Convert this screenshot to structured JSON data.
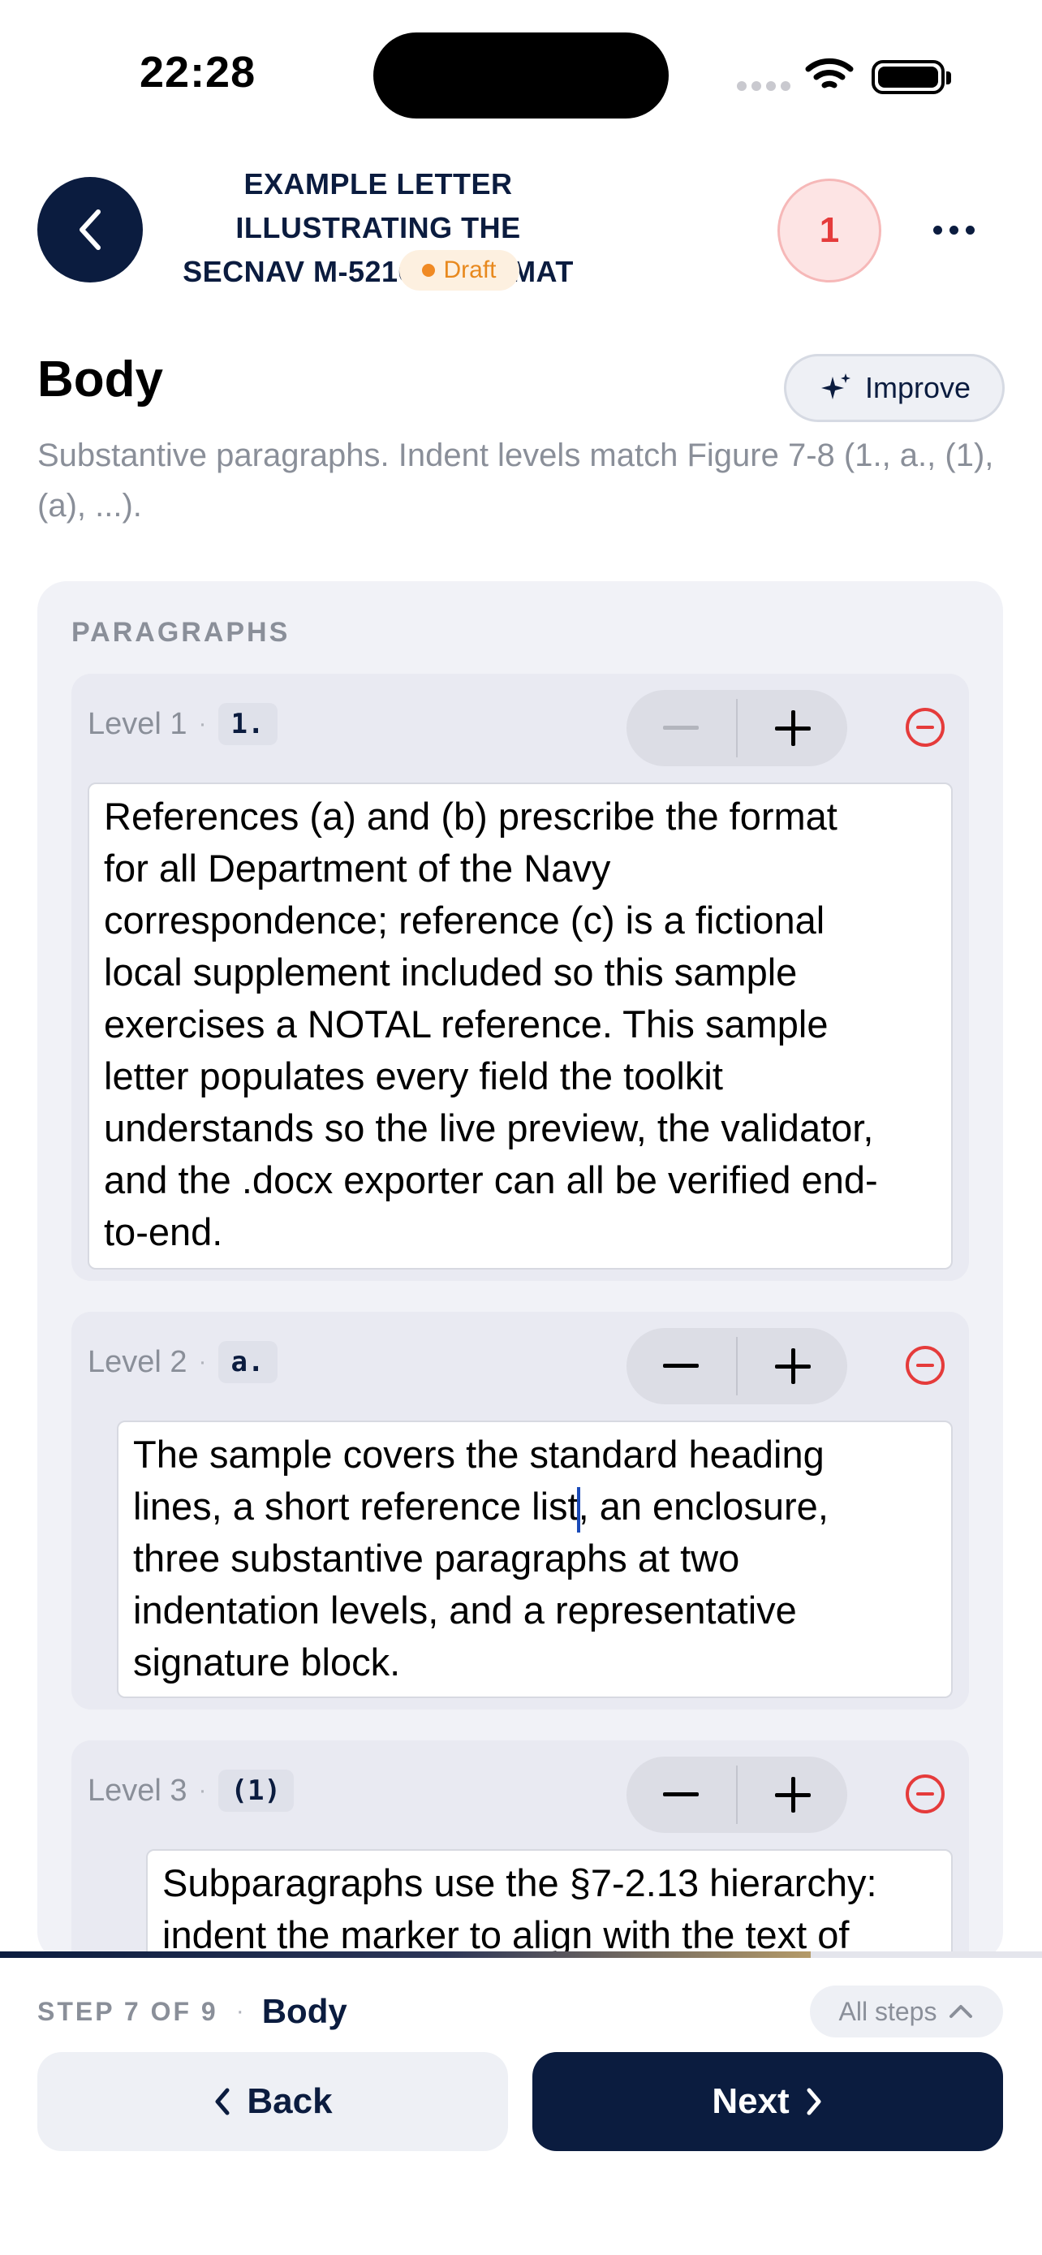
{
  "status_bar": {
    "time": "22:28"
  },
  "header": {
    "title_line1": "EXAMPLE LETTER ILLUSTRATING THE",
    "title_line2": "SECNAV M-5216.5 FORMAT",
    "status_badge": "Draft",
    "issue_count": "1"
  },
  "section": {
    "title": "Body",
    "improve_label": "Improve",
    "description": "Substantive paragraphs. Indent levels match Figure 7-8 (1., a., (1), (a), ...)."
  },
  "paragraphs_label": "PARAGRAPHS",
  "paragraphs": [
    {
      "level_label": "Level 1",
      "marker": "1.",
      "text": "References (a) and (b) prescribe the format\nfor all Department of the Navy\ncorrespondence; reference (c) is a fictional\nlocal supplement included so this sample\nexercises a NOTAL reference. This sample\nletter populates every field the toolkit\nunderstands so the live preview, the validator,\nand the .docx exporter can all be verified end-\nto-end."
    },
    {
      "level_label": "Level 2",
      "marker": "a.",
      "text_before_cursor": "The sample covers the standard heading\nlines, a short reference list",
      "text_after_cursor": ", an enclosure,\nthree substantive paragraphs at two\nindentation levels, and a representative\nsignature block."
    },
    {
      "level_label": "Level 3",
      "marker": "(1)",
      "text": "Subparagraphs use the §7-2.13 hierarchy:\nindent the marker to align with the text of"
    }
  ],
  "footer": {
    "step_count": "STEP 7 OF 9",
    "step_name": "Body",
    "all_steps_label": "All steps",
    "back_label": "Back",
    "next_label": "Next",
    "progress": 0.778
  },
  "colors": {
    "navy": "#0b1c3f",
    "draft_orange": "#f08a24",
    "error_red": "#e53b3b",
    "card_bg": "#f1f2f7"
  }
}
